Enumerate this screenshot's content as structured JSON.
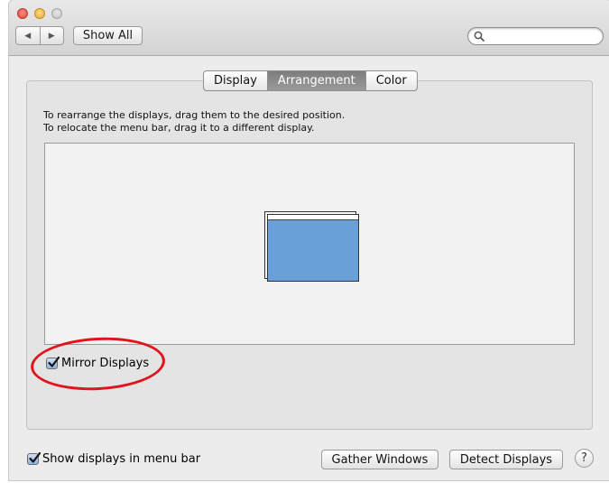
{
  "window": {
    "title": ""
  },
  "toolbar": {
    "back_icon": "◀",
    "forward_icon": "▶",
    "show_all_label": "Show All",
    "search_placeholder": "",
    "search_value": ""
  },
  "tabs": [
    {
      "label": "Display",
      "active": false
    },
    {
      "label": "Arrangement",
      "active": true
    },
    {
      "label": "Color",
      "active": false
    }
  ],
  "instructions": {
    "line1": "To rearrange the displays, drag them to the desired position.",
    "line2": "To relocate the menu bar, drag it to a different display."
  },
  "arrangement": {
    "display_color": "#6aa0d8"
  },
  "mirror": {
    "label": "Mirror Displays",
    "checked": true,
    "highlight_color": "#e2141b"
  },
  "footer": {
    "show_in_menu_bar_label": "Show displays in menu bar",
    "show_in_menu_bar_checked": true,
    "gather_windows_label": "Gather Windows",
    "detect_displays_label": "Detect Displays",
    "help_label": "?"
  }
}
